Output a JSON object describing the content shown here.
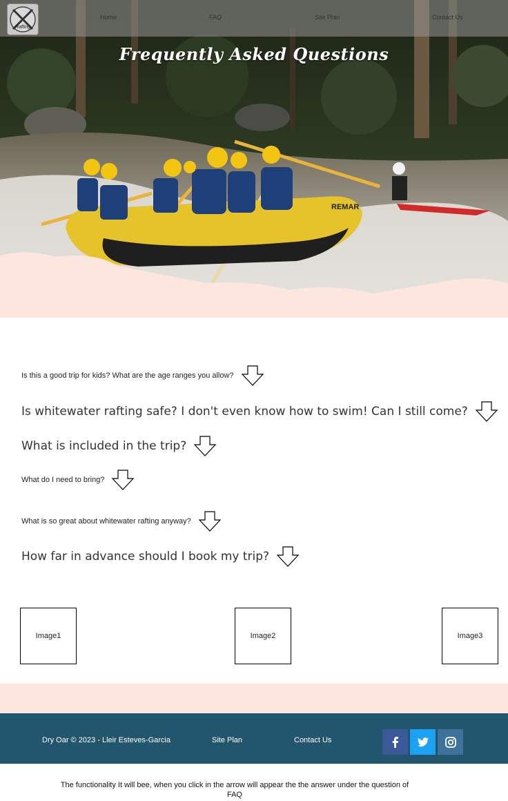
{
  "nav": {
    "logo_text": "Rafting",
    "items": [
      {
        "label": "Home"
      },
      {
        "label": "FAQ"
      },
      {
        "label": "Site Plan"
      },
      {
        "label": "Contact Us"
      }
    ]
  },
  "hero": {
    "title": "Frequently Asked Questions",
    "boat_text": "REMAR"
  },
  "faq": {
    "questions": [
      {
        "text": "Is this a good trip for kids? What are the age ranges you allow?"
      },
      {
        "text": "Is whitewater rafting safe? I don't even know how to swim! Can I still come?"
      },
      {
        "text": "What is included in the trip?"
      },
      {
        "text": "What do I need to bring?"
      },
      {
        "text": "What is so great about whitewater rafting anyway?"
      },
      {
        "text": "How far in advance should I book my trip?"
      }
    ]
  },
  "images": [
    {
      "label": "Image1"
    },
    {
      "label": "Image2"
    },
    {
      "label": "Image3"
    }
  ],
  "footer": {
    "copyright": "Dry Oar © 2023 - Lleir Esteves-Garcia",
    "site_plan": "Site Plan",
    "contact": "Contact Us",
    "social": [
      {
        "icon": "facebook-icon",
        "color": "#3b5998"
      },
      {
        "icon": "twitter-icon",
        "color": "#1da1f2"
      },
      {
        "icon": "instagram-icon",
        "color": "#3f729b"
      }
    ]
  },
  "note": "The functionality It will bee, when you click in the arrow will appear the the answer under the question of FAQ",
  "colors": {
    "pink": "#fce6de",
    "footer_bg": "#22566f"
  }
}
